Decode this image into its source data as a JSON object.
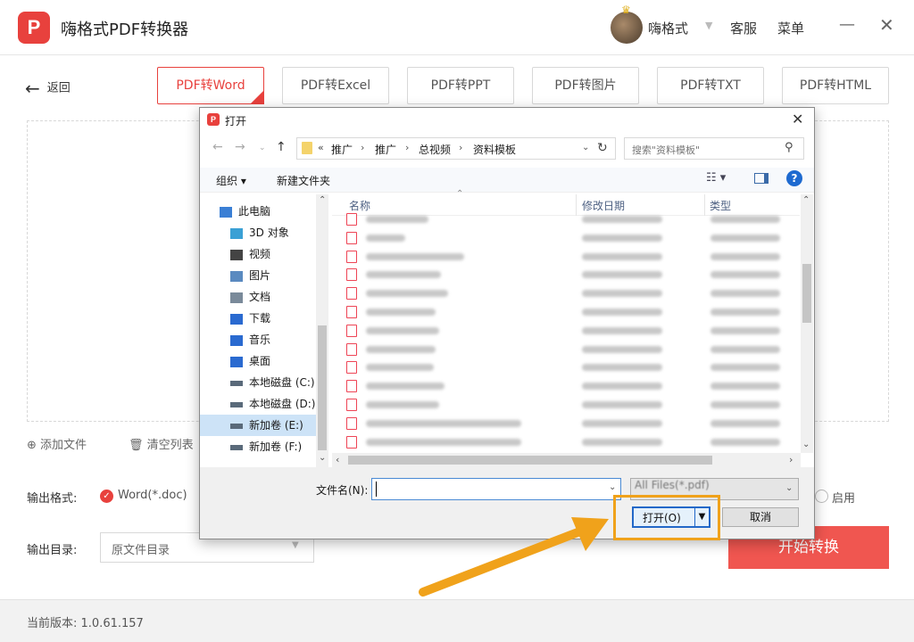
{
  "app": {
    "title": "嗨格式PDF转换器",
    "logo_glyph": "P",
    "username": "嗨格式",
    "service_label": "客服",
    "menu_label": "菜单",
    "minimize_glyph": "—",
    "close_glyph": "✕"
  },
  "nav": {
    "back_label": "返回"
  },
  "tabs": [
    {
      "label": "PDF转Word",
      "active": true
    },
    {
      "label": "PDF转Excel"
    },
    {
      "label": "PDF转PPT"
    },
    {
      "label": "PDF转图片"
    },
    {
      "label": "PDF转TXT"
    },
    {
      "label": "PDF转HTML"
    }
  ],
  "file_actions": {
    "add_file": "添加文件",
    "clear_list": "清空列表"
  },
  "output": {
    "format_label": "输出格式:",
    "format_value": "Word(*.doc)",
    "enable_label": "启用",
    "dir_label": "输出目录:",
    "dir_value": "原文件目录"
  },
  "start_button": "开始转换",
  "footer": {
    "version": "当前版本: 1.0.61.157"
  },
  "dialog": {
    "title": "打开",
    "address": {
      "overflow": "«",
      "crumbs": [
        "推广",
        "推广",
        "总视频",
        "资料模板"
      ]
    },
    "search_placeholder": "搜索\"资料模板\"",
    "toolbar": {
      "organize": "组织 ▾",
      "new_folder": "新建文件夹",
      "help": "?"
    },
    "nav_tree": [
      {
        "label": "此电脑",
        "icon": "monitor-icon",
        "color": "#3a7fd5"
      },
      {
        "label": "3D 对象",
        "icon": "cube-icon",
        "color": "#3aa0d5"
      },
      {
        "label": "视频",
        "icon": "film-icon",
        "color": "#444444"
      },
      {
        "label": "图片",
        "icon": "image-icon",
        "color": "#5a8ac0"
      },
      {
        "label": "文档",
        "icon": "document-icon",
        "color": "#7a8a9a"
      },
      {
        "label": "下载",
        "icon": "download-icon",
        "color": "#2a6ad0"
      },
      {
        "label": "音乐",
        "icon": "music-icon",
        "color": "#2a6ad0"
      },
      {
        "label": "桌面",
        "icon": "desktop-icon",
        "color": "#2a6ad0"
      },
      {
        "label": "本地磁盘 (C:)",
        "icon": "windows-drive-icon",
        "color": "#5a6a7a"
      },
      {
        "label": "本地磁盘 (D:)",
        "icon": "drive-icon",
        "color": "#5a6a7a"
      },
      {
        "label": "新加卷 (E:)",
        "icon": "drive-icon",
        "color": "#5a6a7a",
        "selected": true
      },
      {
        "label": "新加卷 (F:)",
        "icon": "drive-icon",
        "color": "#5a6a7a"
      }
    ],
    "columns": {
      "name": "名称",
      "modified": "修改日期",
      "type": "类型"
    },
    "filename_label": "文件名(N):",
    "filter_value": "All Files(*.pdf)",
    "open_button": "打开(O)",
    "cancel_button": "取消"
  },
  "colors": {
    "accent": "#e8413d",
    "start_button": "#f05650",
    "highlight": "#f0a21b",
    "arrow": "#f0a21b"
  }
}
